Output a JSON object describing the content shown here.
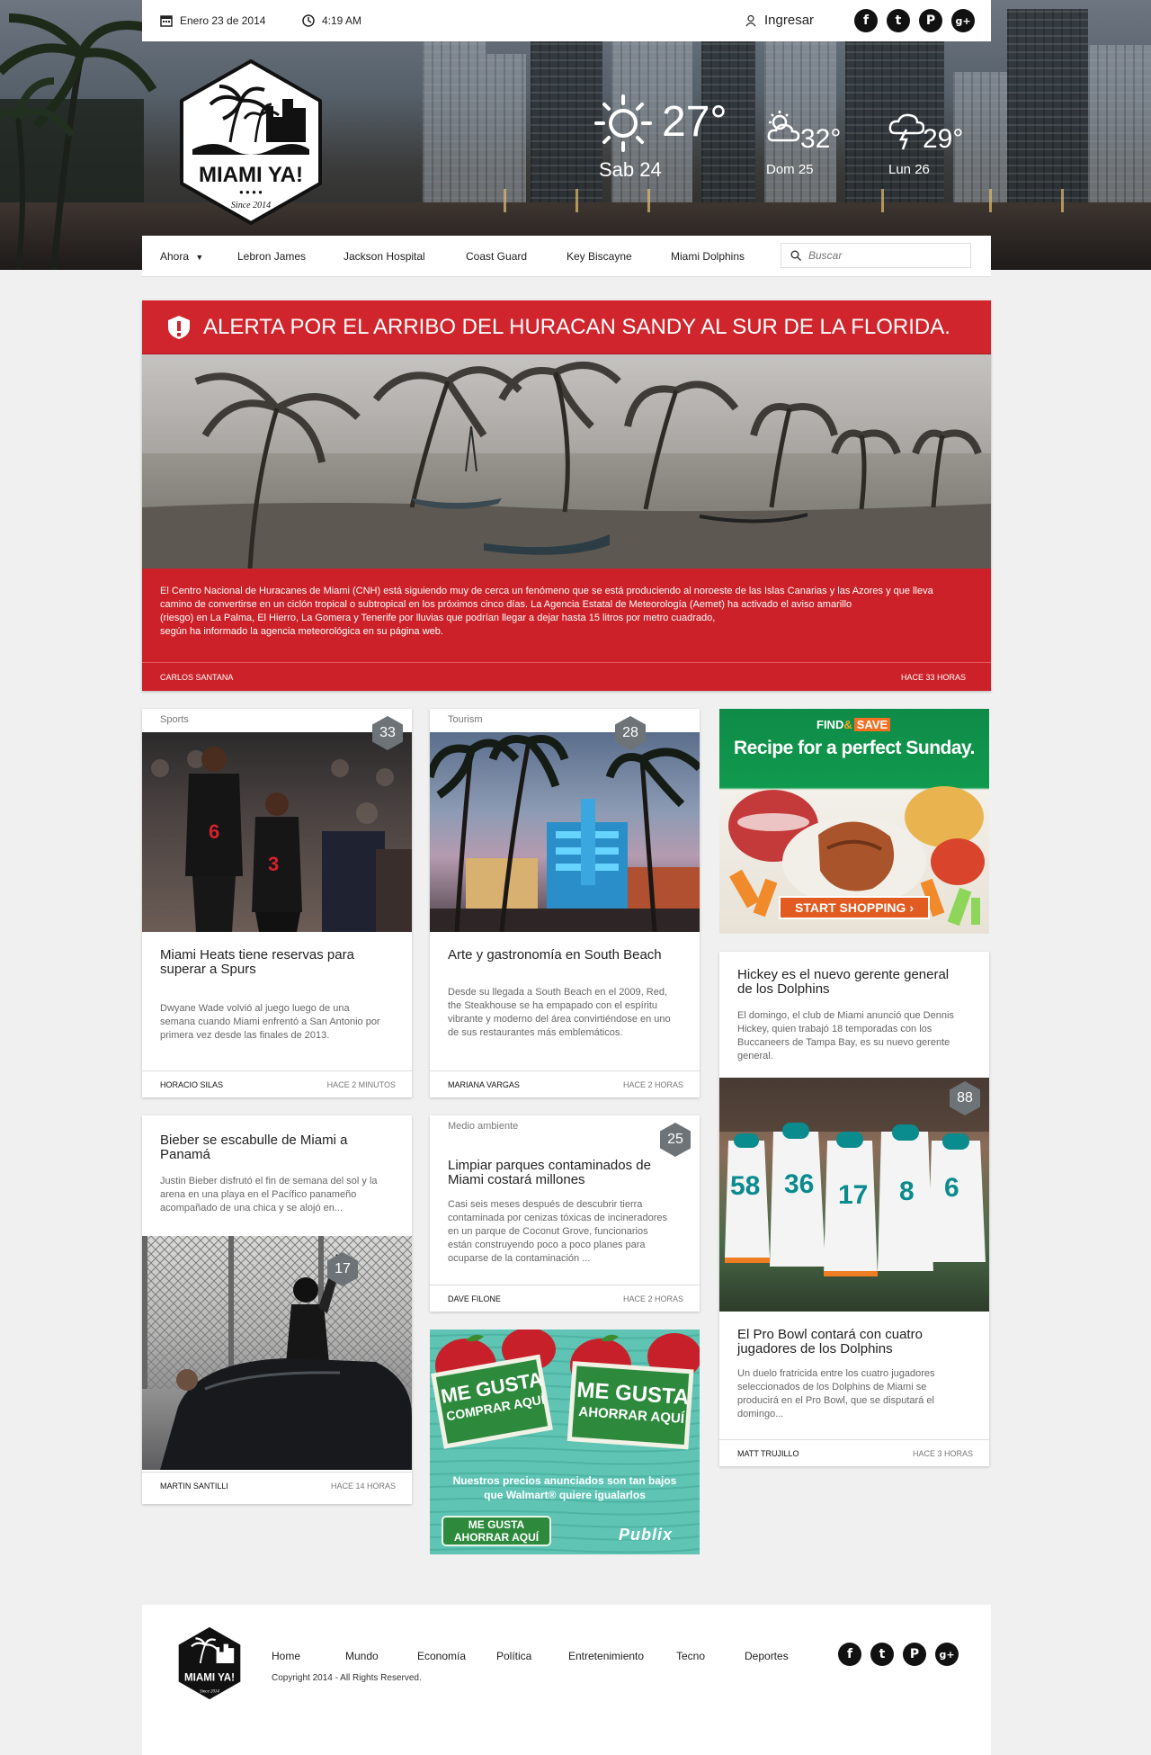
{
  "topbar": {
    "date": "Enero 23 de 2014",
    "time": "4:19 AM",
    "login": "Ingresar",
    "socials": [
      {
        "name": "facebook",
        "glyph": "f"
      },
      {
        "name": "twitter",
        "glyph": "t"
      },
      {
        "name": "pinterest",
        "glyph": "P"
      },
      {
        "name": "google-plus",
        "glyph": "g+"
      }
    ]
  },
  "logo": {
    "name": "MIAMI YA!",
    "since": "Since 2014"
  },
  "weather": {
    "today": {
      "temp": "27°",
      "day": "Sab 24",
      "icon": "sun-icon"
    },
    "next": [
      {
        "temp": "32°",
        "day": "Dom 25",
        "icon": "partly-cloudy-icon"
      },
      {
        "temp": "29°",
        "day": "Lun 26",
        "icon": "storm-icon"
      }
    ]
  },
  "nav": {
    "items": [
      "Ahora",
      "Lebron James",
      "Jackson Hospital",
      "Coast Guard",
      "Key Biscayne",
      "Miami Dolphins"
    ],
    "search_placeholder": "Buscar"
  },
  "alert": {
    "title": "ALERTA POR EL ARRIBO DEL HURACAN SANDY AL SUR DE LA FLORIDA.",
    "body": [
      "El Centro Nacional de Huracanes de Miami (CNH) está siguiendo muy de cerca un fenómeno que se está produciendo al noroeste de las Islas Canarias y las Azores y que lleva",
      "camino de convertirse en un ciclón tropical o subtropical en los próximos cinco días. La Agencia Estatal de Meteorología (Aemet) ha activado el aviso amarillo",
      "(riesgo) en La Palma, El Hierro, La Gomera y Tenerife por lluvias que podrían llegar a dejar hasta 15 litros por metro cuadrado,",
      "según ha informado la agencia meteorológica en su página web."
    ],
    "author": "CARLOS SANTANA",
    "time": "HACE 33 HORAS"
  },
  "cards": {
    "heat": {
      "category": "Sports",
      "count": "33",
      "title": [
        "Miami Heats tiene reservas para",
        "superar a Spurs"
      ],
      "text": [
        "Dwyane Wade volvió al juego luego de una",
        "semana cuando Miami enfrentó a San Antonio por",
        "primera vez desde las finales de 2013."
      ],
      "author": "HORACIO SILAS",
      "time": "HACE 2 MINUTOS"
    },
    "southbeach": {
      "category": "Tourism",
      "count": "28",
      "title": [
        "Arte y gastronomía en South Beach"
      ],
      "text": [
        "Desde su llegada a South Beach en el 2009, Red,",
        "the Steakhouse se ha empapado con el espíritu",
        "vibrante y moderno del área convirtiéndose en uno",
        "de sus restaurantes más emblemáticos."
      ],
      "author": "MARIANA VARGAS",
      "time": "HACE 2 HORAS"
    },
    "bieber": {
      "count": "17",
      "title": [
        "Bieber se escabulle de Miami a",
        "Panamá"
      ],
      "text": [
        "Justin Bieber disfrutó el fin de semana del sol y la",
        "arena en una playa en el Pacífico panameño",
        "acompañado de una chica y se alojó en..."
      ],
      "author": "MARTIN SANTILLI",
      "time": "HACE 14 HORAS"
    },
    "parques": {
      "category": "Medio ambiente",
      "count": "25",
      "title": [
        "Limpiar parques contaminados de",
        "Miami costará millones"
      ],
      "text": [
        "Casi seis meses después de descubrir tierra",
        "contaminada por cenizas tóxicas de incineradores",
        "en un parque de Coconut Grove, funcionarios",
        "están construyendo poco a poco planes para",
        "ocuparse de la contaminación ..."
      ],
      "author": "DAVE FILONE",
      "time": "HACE 2 HORAS"
    },
    "dolphins": {
      "count": "88",
      "title1": [
        "Hickey es el nuevo gerente general",
        "de los Dolphins"
      ],
      "text1": [
        "El domingo, el club de Miami anunció que Dennis",
        "Hickey, quien trabajó 18 temporadas con los",
        "Buccaneers de Tampa Bay, es su nuevo gerente",
        "general."
      ],
      "title2": [
        "El Pro Bowl contará con cuatro",
        "jugadores de los Dolphins"
      ],
      "text2": [
        "Un duelo fratricida entre los cuatro jugadores",
        "seleccionados de los Dolphins de Miami se",
        "producirá en el Pro Bowl, que se disputará el",
        "domingo..."
      ],
      "author": "MATT TRUJILLO",
      "time": "HACE 3 HORAS"
    }
  },
  "ads": {
    "food": {
      "brand_a": "FIND",
      "brand_amp": "&",
      "brand_b": "SAVE",
      "headline": "Recipe for a perfect Sunday.",
      "cta": "START SHOPPING ›"
    },
    "publix": {
      "sign1": [
        "ME GUSTA",
        "COMPRAR AQUÍ"
      ],
      "sign2": [
        "ME GUSTA",
        "AHORRAR AQUÍ"
      ],
      "line1": "Nuestros precios anunciados son tan bajos",
      "line2": "que Walmart® quiere igualarlos",
      "button": [
        "ME GUSTA",
        "AHORRAR AQUÍ"
      ],
      "brand": "Publix"
    }
  },
  "footer": {
    "nav": [
      "Home",
      "Mundo",
      "Economía",
      "Política",
      "Entretenimiento",
      "Tecno",
      "Deportes"
    ],
    "copyright": "Copyright 2014 - All Rights Reserved."
  }
}
